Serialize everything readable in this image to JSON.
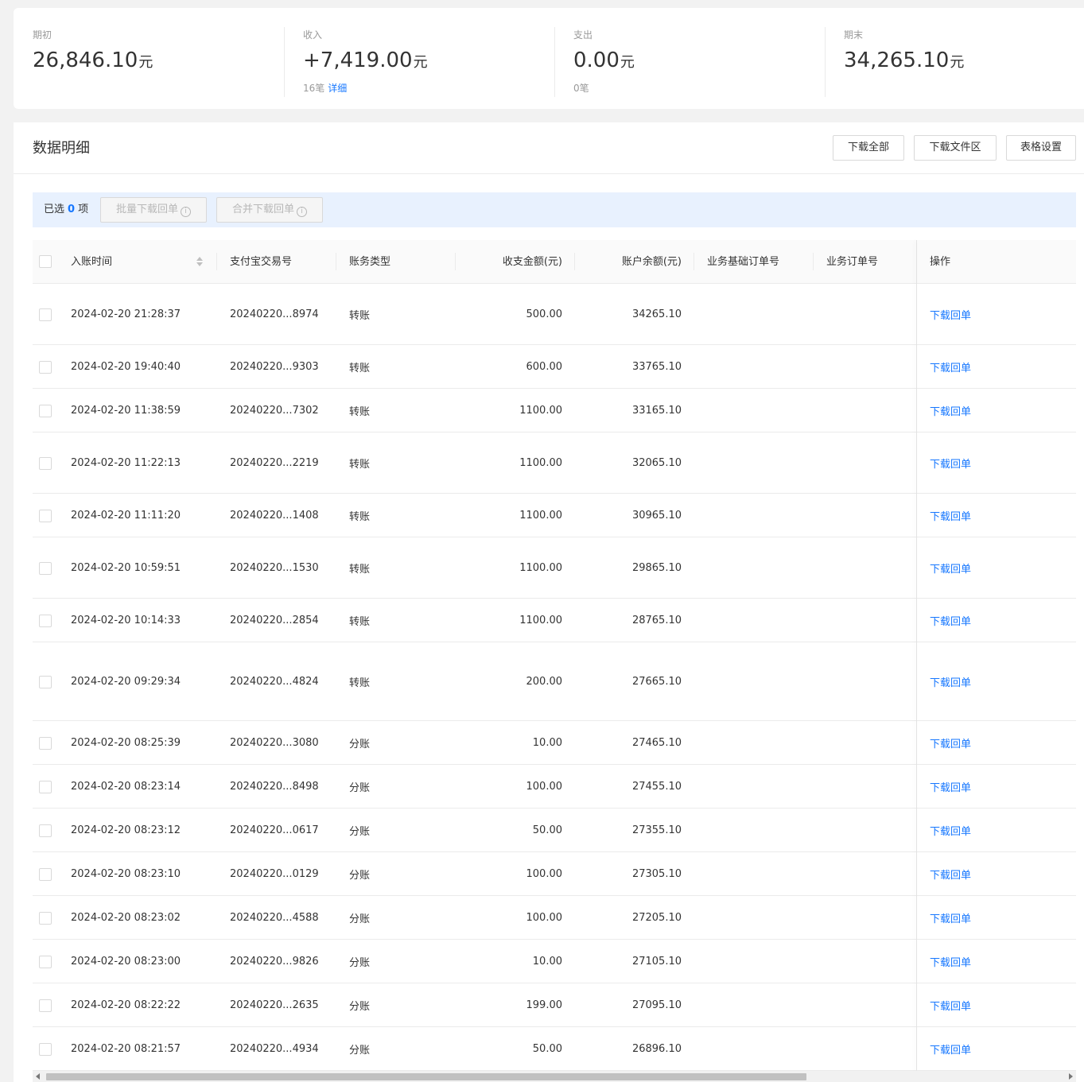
{
  "summary": {
    "opening": {
      "label": "期初",
      "amount": "26,846.10",
      "unit": "元"
    },
    "income": {
      "label": "收入",
      "amount": "+7,419.00",
      "unit": "元",
      "count": "16笔",
      "detail_link": "详细"
    },
    "expense": {
      "label": "支出",
      "amount": "0.00",
      "unit": "元",
      "count": "0笔"
    },
    "closing": {
      "label": "期末",
      "amount": "34,265.10",
      "unit": "元"
    }
  },
  "main": {
    "title": "数据明细",
    "buttons": {
      "download_all": "下载全部",
      "download_files": "下载文件区",
      "table_settings": "表格设置"
    }
  },
  "selection": {
    "prefix": "已选",
    "count": "0",
    "suffix": "项",
    "batch_download": "批量下载回单",
    "merge_download": "合并下载回单",
    "info_glyph": "i"
  },
  "table": {
    "columns": {
      "time": "入账时间",
      "trade_no": "支付宝交易号",
      "type": "账务类型",
      "amount": "收支金额(元)",
      "balance": "账户余额(元)",
      "base_order": "业务基础订单号",
      "biz_order": "业务订单号",
      "action": "操作"
    },
    "rows": [
      {
        "time": "2024-02-20 21:28:37",
        "trade_no": "20240220...8974",
        "type": "转账",
        "amount": "500.00",
        "balance": "34265.10",
        "action": "下载回单"
      },
      {
        "time": "2024-02-20 19:40:40",
        "trade_no": "20240220...9303",
        "type": "转账",
        "amount": "600.00",
        "balance": "33765.10",
        "action": "下载回单"
      },
      {
        "time": "2024-02-20 11:38:59",
        "trade_no": "20240220...7302",
        "type": "转账",
        "amount": "1100.00",
        "balance": "33165.10",
        "action": "下载回单"
      },
      {
        "time": "2024-02-20 11:22:13",
        "trade_no": "20240220...2219",
        "type": "转账",
        "amount": "1100.00",
        "balance": "32065.10",
        "action": "下载回单"
      },
      {
        "time": "2024-02-20 11:11:20",
        "trade_no": "20240220...1408",
        "type": "转账",
        "amount": "1100.00",
        "balance": "30965.10",
        "action": "下载回单"
      },
      {
        "time": "2024-02-20 10:59:51",
        "trade_no": "20240220...1530",
        "type": "转账",
        "amount": "1100.00",
        "balance": "29865.10",
        "action": "下载回单"
      },
      {
        "time": "2024-02-20 10:14:33",
        "trade_no": "20240220...2854",
        "type": "转账",
        "amount": "1100.00",
        "balance": "28765.10",
        "action": "下载回单"
      },
      {
        "time": "2024-02-20 09:29:34",
        "trade_no": "20240220...4824",
        "type": "转账",
        "amount": "200.00",
        "balance": "27665.10",
        "action": "下载回单"
      },
      {
        "time": "2024-02-20 08:25:39",
        "trade_no": "20240220...3080",
        "type": "分账",
        "amount": "10.00",
        "balance": "27465.10",
        "action": "下载回单"
      },
      {
        "time": "2024-02-20 08:23:14",
        "trade_no": "20240220...8498",
        "type": "分账",
        "amount": "100.00",
        "balance": "27455.10",
        "action": "下载回单"
      },
      {
        "time": "2024-02-20 08:23:12",
        "trade_no": "20240220...0617",
        "type": "分账",
        "amount": "50.00",
        "balance": "27355.10",
        "action": "下载回单"
      },
      {
        "time": "2024-02-20 08:23:10",
        "trade_no": "20240220...0129",
        "type": "分账",
        "amount": "100.00",
        "balance": "27305.10",
        "action": "下载回单"
      },
      {
        "time": "2024-02-20 08:23:02",
        "trade_no": "20240220...4588",
        "type": "分账",
        "amount": "100.00",
        "balance": "27205.10",
        "action": "下载回单"
      },
      {
        "time": "2024-02-20 08:23:00",
        "trade_no": "20240220...9826",
        "type": "分账",
        "amount": "10.00",
        "balance": "27105.10",
        "action": "下载回单"
      },
      {
        "time": "2024-02-20 08:22:22",
        "trade_no": "20240220...2635",
        "type": "分账",
        "amount": "199.00",
        "balance": "27095.10",
        "action": "下载回单"
      },
      {
        "time": "2024-02-20 08:21:57",
        "trade_no": "20240220...4934",
        "type": "分账",
        "amount": "50.00",
        "balance": "26896.10",
        "action": "下载回单"
      }
    ]
  },
  "colors": {
    "link": "#1677ff",
    "selection_bar": "#e8f1fe"
  },
  "icons": {
    "sort": "sort-caret-icon",
    "info": "info-circle-icon",
    "scroll_left": "arrow-left-icon",
    "scroll_right": "arrow-right-icon"
  }
}
